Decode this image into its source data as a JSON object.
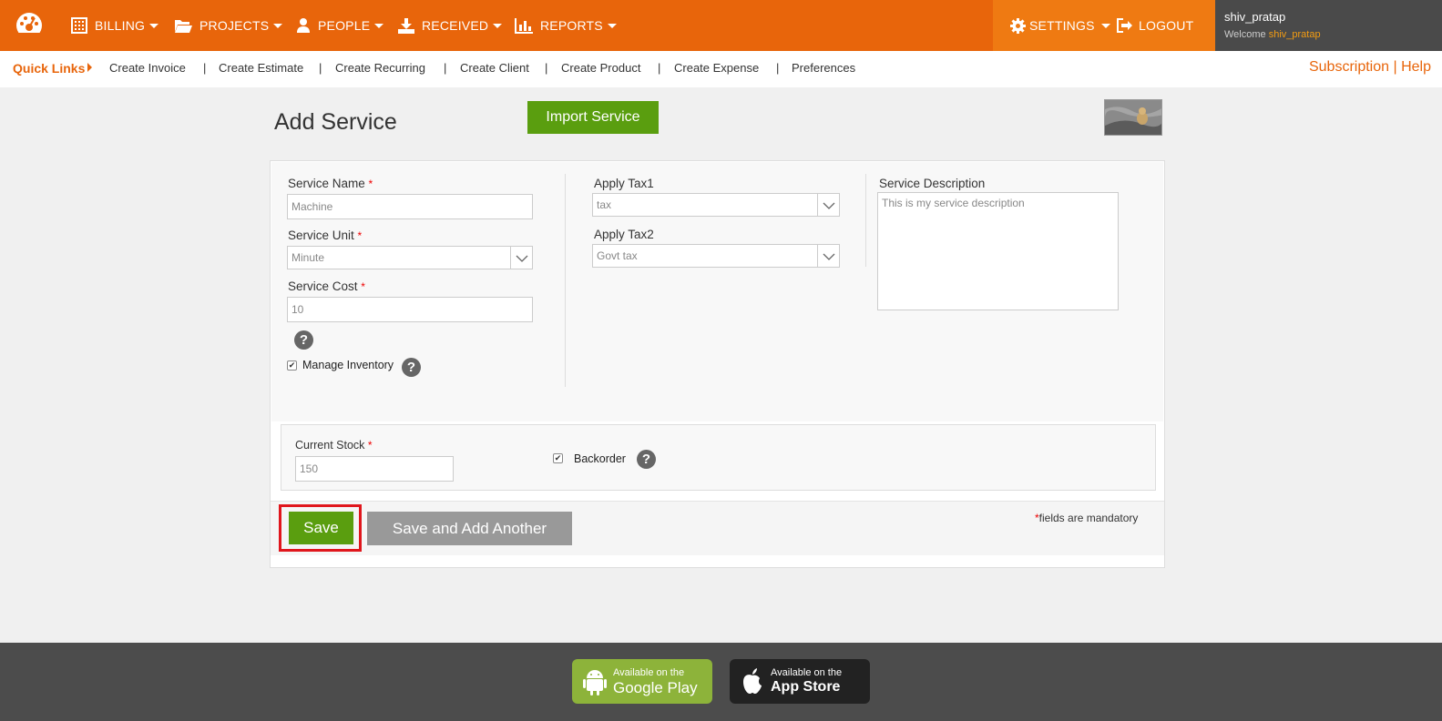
{
  "nav": {
    "items": [
      {
        "label": "BILLING",
        "icon": "calculator-icon"
      },
      {
        "label": "PROJECTS",
        "icon": "folder-open-icon"
      },
      {
        "label": "PEOPLE",
        "icon": "user-icon"
      },
      {
        "label": "RECEIVED",
        "icon": "download-icon"
      },
      {
        "label": "REPORTS",
        "icon": "bar-chart-icon"
      }
    ],
    "settings": "SETTINGS",
    "logout": "LOGOUT",
    "user_name": "shiv_pratap",
    "welcome_prefix": "Welcome",
    "welcome_user": "shiv_pratap"
  },
  "quicklinks": {
    "title": "Quick Links",
    "links": [
      "Create Invoice",
      "Create Estimate",
      "Create Recurring",
      "Create Client",
      "Create Product",
      "Create Expense",
      "Preferences"
    ],
    "separator": "|",
    "subscription": "Subscription",
    "help": "Help"
  },
  "page": {
    "title": "Add Service",
    "import_button": "Import Service"
  },
  "form": {
    "service_name_label": "Service Name",
    "service_name_value": "Machine",
    "service_unit_label": "Service Unit",
    "service_unit_value": "Minute",
    "service_cost_label": "Service Cost",
    "service_cost_value": "10",
    "manage_inventory_label": "Manage Inventory",
    "manage_inventory_checked": true,
    "tax1_label": "Apply Tax1",
    "tax1_value": "tax",
    "tax2_label": "Apply Tax2",
    "tax2_value": "Govt tax",
    "description_label": "Service Description",
    "description_value": "This is my service description",
    "current_stock_label": "Current Stock",
    "current_stock_value": "150",
    "backorder_label": "Backorder",
    "backorder_checked": true,
    "required_mark": "*",
    "help_glyph": "?",
    "check_glyph": "✔"
  },
  "actions": {
    "save": "Save",
    "save_another": "Save and Add Another",
    "mandatory_note": "fields are mandatory"
  },
  "footer": {
    "google_play_line1": "Available on the",
    "google_play_line2": "Google Play",
    "app_store_line1": "Available on the",
    "app_store_line2": "App Store"
  },
  "colors": {
    "brand_orange": "#e8650b",
    "save_green": "#5a9e0f",
    "highlight_red": "#e0161c",
    "footer_dark": "#4c4c4c"
  }
}
